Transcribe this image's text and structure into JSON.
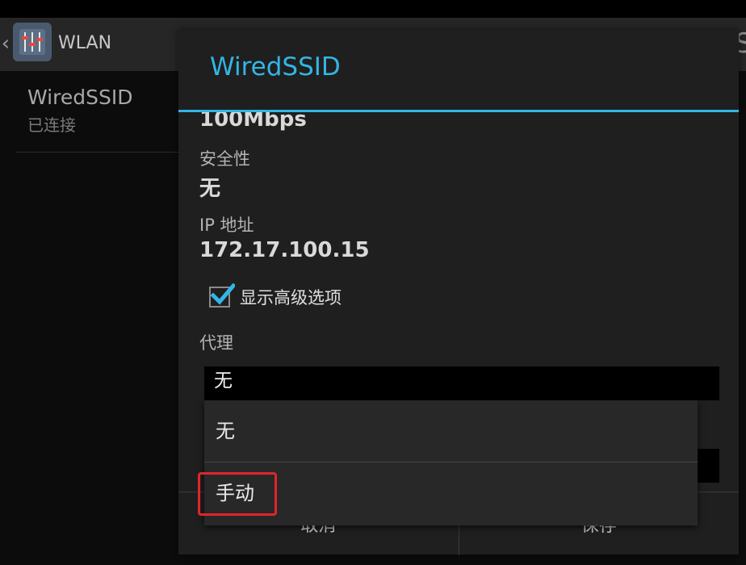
{
  "action_bar": {
    "title": "WLAN",
    "edge_glyph": "S"
  },
  "network_list": [
    {
      "name": "WiredSSID",
      "status": "已连接"
    }
  ],
  "dialog": {
    "title": "WiredSSID",
    "speed_value": "100Mbps",
    "security_label": "安全性",
    "security_value": "无",
    "ip_label": "IP 地址",
    "ip_value": "172.17.100.15",
    "advanced_checkbox": {
      "label": "显示高级选项",
      "checked": true
    },
    "proxy_label": "代理",
    "proxy_value": "无",
    "cancel_label": "取消",
    "save_label": "保存"
  },
  "dropdown": {
    "options": [
      "无",
      "手动"
    ],
    "highlighted": "手动"
  },
  "colors": {
    "accent": "#33b5e5",
    "highlight": "#e0262c"
  }
}
